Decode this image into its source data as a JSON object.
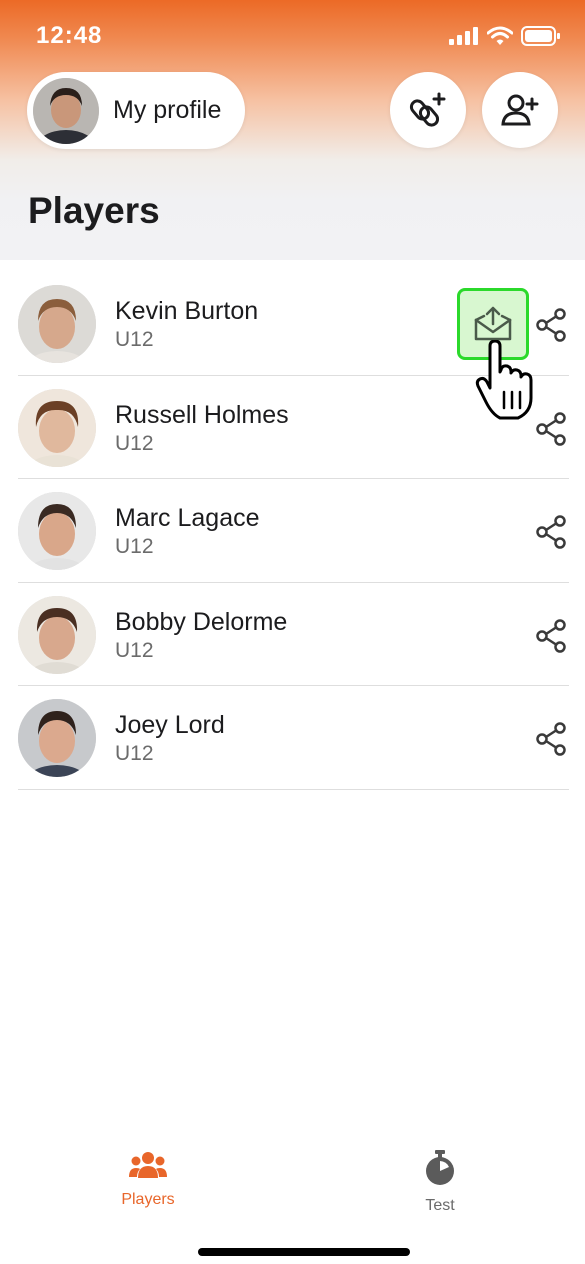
{
  "status_bar": {
    "time": "12:48"
  },
  "header": {
    "profile_label": "My profile",
    "page_title": "Players"
  },
  "players": [
    {
      "name": "Kevin Burton",
      "team": "U12"
    },
    {
      "name": "Russell Holmes",
      "team": "U12"
    },
    {
      "name": "Marc Lagace",
      "team": "U12"
    },
    {
      "name": "Bobby Delorme",
      "team": "U12"
    },
    {
      "name": "Joey Lord",
      "team": "U12"
    }
  ],
  "tabs": [
    {
      "label": "Players",
      "icon": "team-icon",
      "active": true
    },
    {
      "label": "Test",
      "icon": "stopwatch-icon",
      "active": false
    }
  ],
  "colors": {
    "accent": "#e8662a",
    "highlight_border": "#2bd92b",
    "highlight_fill": "#d8f7d0"
  }
}
